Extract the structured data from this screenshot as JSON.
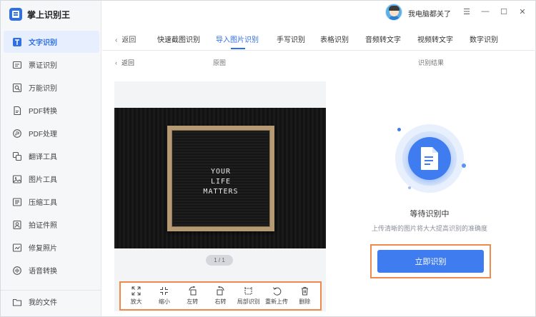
{
  "app": {
    "title": "掌上识别王",
    "user_name": "我电脑都关了"
  },
  "window_controls": {
    "menu": "☰",
    "minimize": "—",
    "maximize": "☐",
    "close": "✕"
  },
  "sidebar": {
    "items": [
      {
        "label": "文字识别",
        "icon": "text-recognition-icon",
        "active": true
      },
      {
        "label": "票证识别",
        "icon": "ticket-icon"
      },
      {
        "label": "万能识别",
        "icon": "scan-icon"
      },
      {
        "label": "PDF转换",
        "icon": "pdf-convert-icon"
      },
      {
        "label": "PDF处理",
        "icon": "pdf-process-icon"
      },
      {
        "label": "翻译工具",
        "icon": "translate-icon"
      },
      {
        "label": "图片工具",
        "icon": "image-icon"
      },
      {
        "label": "压缩工具",
        "icon": "compress-icon"
      },
      {
        "label": "拍证件照",
        "icon": "id-photo-icon"
      },
      {
        "label": "修复照片",
        "icon": "repair-photo-icon"
      },
      {
        "label": "语音转换",
        "icon": "voice-icon"
      }
    ],
    "bottom_item": {
      "label": "我的文件",
      "icon": "folder-icon"
    }
  },
  "tabs": {
    "back_label": "返回",
    "items": [
      {
        "label": "快速截图识别"
      },
      {
        "label": "导入图片识别",
        "active": true
      },
      {
        "label": "手写识别"
      },
      {
        "label": "表格识别"
      },
      {
        "label": "音频转文字"
      },
      {
        "label": "视频转文字"
      },
      {
        "label": "数字识别"
      }
    ]
  },
  "subheader": {
    "back_label": "返回",
    "original_label": "原图",
    "result_label": "识别结果"
  },
  "preview": {
    "image_text_lines": [
      "YOUR",
      "LIFE",
      "MATTERS"
    ],
    "pager": "1 / 1"
  },
  "toolbar": {
    "tools": [
      {
        "label": "放大",
        "icon": "zoom-in-icon"
      },
      {
        "label": "缩小",
        "icon": "zoom-out-icon"
      },
      {
        "label": "左转",
        "icon": "rotate-left-icon"
      },
      {
        "label": "右转",
        "icon": "rotate-right-icon"
      },
      {
        "label": "局部识别",
        "icon": "crop-icon"
      },
      {
        "label": "重新上传",
        "icon": "reupload-icon"
      },
      {
        "label": "删除",
        "icon": "trash-icon"
      }
    ]
  },
  "result": {
    "status_title": "等待识别中",
    "hint": "上传清晰的图片将大大提高识别的准确度",
    "action_label": "立即识别"
  },
  "colors": {
    "accent": "#3e7cf0",
    "highlight_border": "#ef8a4a",
    "sidebar_active_bg": "#e7efff"
  }
}
